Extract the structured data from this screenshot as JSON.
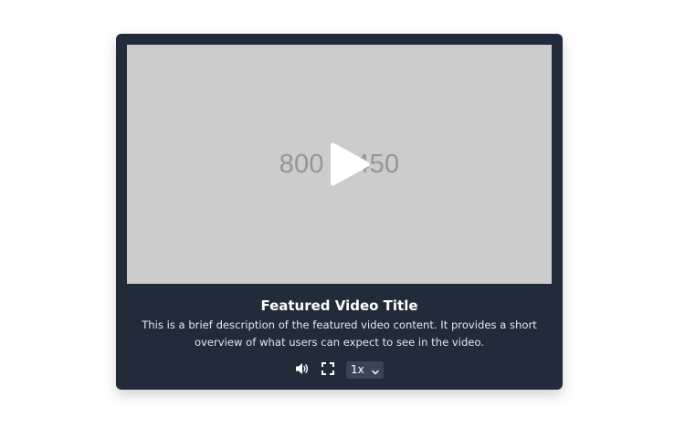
{
  "player": {
    "placeholder_text": "800 × 450",
    "play_icon": "play-icon"
  },
  "info": {
    "title": "Featured Video Title",
    "description": "This is a brief description of the featured video content. It provides a short overview of what users can expect to see in the video."
  },
  "controls": {
    "volume_icon": "volume-icon",
    "fullscreen_icon": "fullscreen-icon",
    "speed": {
      "selected": "1x"
    }
  },
  "colors": {
    "card_background": "#222b3a",
    "video_placeholder": "#cccccc",
    "placeholder_text": "#969696",
    "control_select_bg": "#3a4456",
    "text": "#ffffff"
  }
}
